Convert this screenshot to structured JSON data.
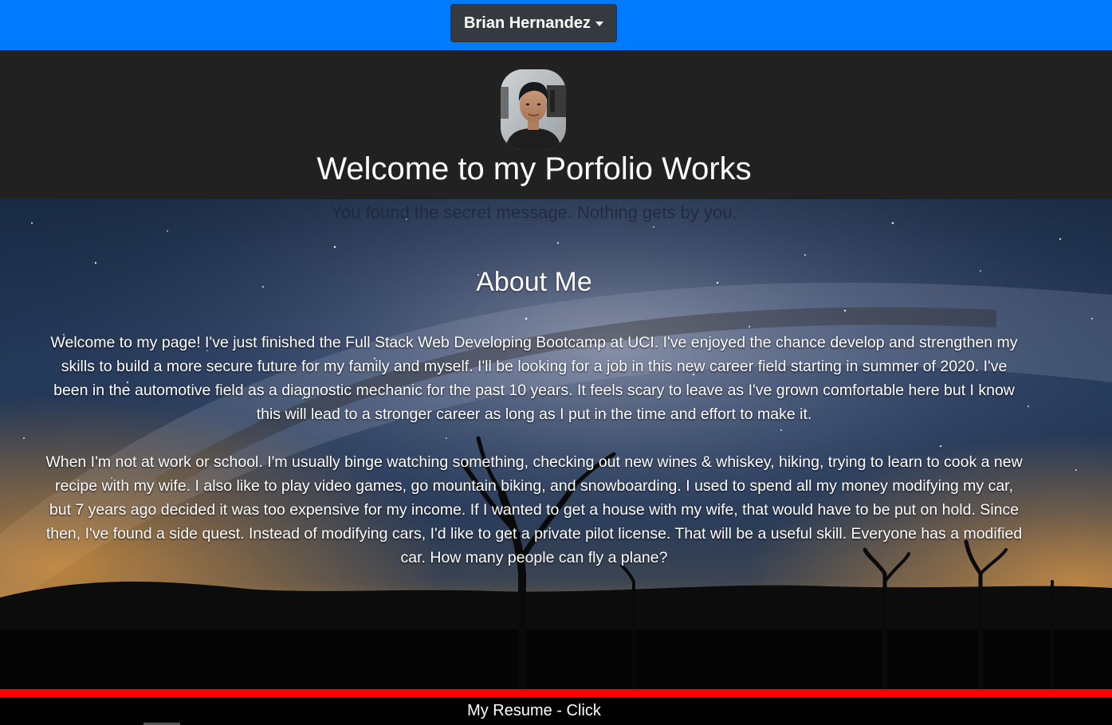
{
  "topbar": {
    "color": "#007bff",
    "dropdown_label": "Brian Hernandez"
  },
  "header": {
    "avatar_icon": "profile-photo",
    "title": "Welcome to my Porfolio Works"
  },
  "hero": {
    "secret_text": "You found the secret message. Nothing gets by you.",
    "about_title": "About Me",
    "paragraphs": [
      "Welcome to my page! I've just finished the Full Stack Web Developing Bootcamp at UCI. I've enjoyed the chance develop and strengthen my skills to build a more secure future for my family and myself. I'll be looking for a job in this new career field starting in summer of 2020. I've been in the automotive field as a diagnostic mechanic for the past 10 years. It feels scary to leave as I've grown comfortable here but I know this will lead to a stronger career as long as I put in the time and effort to make it.",
      "When I'm not at work or school. I'm usually binge watching something, checking out new wines & whiskey, hiking, trying to learn to cook a new recipe with my wife. I also like to play video games, go mountain biking, and snowboarding. I used to spend all my money modifying my car, but 7 years ago decided it was too expensive for my income. If I wanted to get a house with my wife, that would have to be put on hold. Since then, I've found a side quest. Instead of modifying cars, I'd like to get a private pilot license. That will be a useful skill. Everyone has a modified car. How many people can fly a plane?"
    ]
  },
  "footer": {
    "accent_color": "#ff0000",
    "resume_label": "My Resume - Click"
  }
}
